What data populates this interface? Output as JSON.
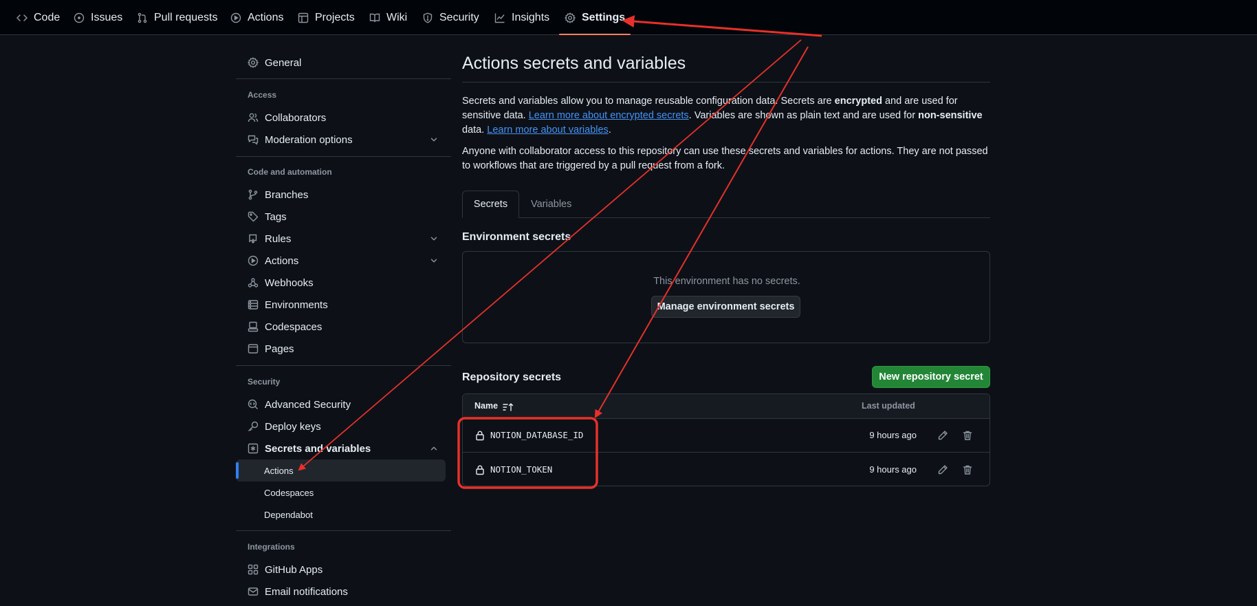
{
  "repo_nav": {
    "tabs": [
      {
        "label": "Code",
        "icon": "code-icon"
      },
      {
        "label": "Issues",
        "icon": "issue-opened-icon"
      },
      {
        "label": "Pull requests",
        "icon": "git-pull-request-icon"
      },
      {
        "label": "Actions",
        "icon": "play-icon"
      },
      {
        "label": "Projects",
        "icon": "table-icon"
      },
      {
        "label": "Wiki",
        "icon": "book-icon"
      },
      {
        "label": "Security",
        "icon": "shield-icon"
      },
      {
        "label": "Insights",
        "icon": "graph-icon"
      },
      {
        "label": "Settings",
        "icon": "gear-icon",
        "active": true
      }
    ]
  },
  "sidebar": {
    "general": "General",
    "access_heading": "Access",
    "collaborators": "Collaborators",
    "moderation": "Moderation options",
    "code_heading": "Code and automation",
    "branches": "Branches",
    "tags": "Tags",
    "rules": "Rules",
    "actions": "Actions",
    "webhooks": "Webhooks",
    "environments": "Environments",
    "codespaces": "Codespaces",
    "pages": "Pages",
    "security_heading": "Security",
    "advanced_security": "Advanced Security",
    "deploy_keys": "Deploy keys",
    "secrets_variables": "Secrets and variables",
    "sub_actions": "Actions",
    "sub_codespaces": "Codespaces",
    "sub_dependabot": "Dependabot",
    "integrations_heading": "Integrations",
    "github_apps": "GitHub Apps",
    "email_notifications": "Email notifications"
  },
  "main": {
    "title": "Actions secrets and variables",
    "intro": {
      "p1_a": "Secrets and variables allow you to manage reusable configuration data. Secrets are ",
      "p1_b": "encrypted",
      "p1_c": " and are used for sensitive data. ",
      "p1_link1": "Learn more about encrypted secrets",
      "p1_d": ". Variables are shown as plain text and are used for ",
      "p1_e": "non-sensitive",
      "p1_f": " data. ",
      "p1_link2": "Learn more about variables",
      "p1_g": ".",
      "p2": "Anyone with collaborator access to this repository can use these secrets and variables for actions. They are not passed to workflows that are triggered by a pull request from a fork."
    },
    "tabs": {
      "secrets": "Secrets",
      "variables": "Variables"
    },
    "env_secrets": {
      "title": "Environment secrets",
      "empty": "This environment has no secrets.",
      "manage_button": "Manage environment secrets"
    },
    "repo_secrets": {
      "title": "Repository secrets",
      "new_button": "New repository secret",
      "columns": {
        "name": "Name",
        "last_updated": "Last updated"
      },
      "rows": [
        {
          "name": "NOTION_DATABASE_ID",
          "updated": "9 hours ago"
        },
        {
          "name": "NOTION_TOKEN",
          "updated": "9 hours ago"
        }
      ]
    }
  },
  "colors": {
    "background": "#0d1117",
    "accent_underline": "#f78166",
    "link": "#4493f8",
    "primary_button": "#238636",
    "annotation": "#e8302a"
  }
}
